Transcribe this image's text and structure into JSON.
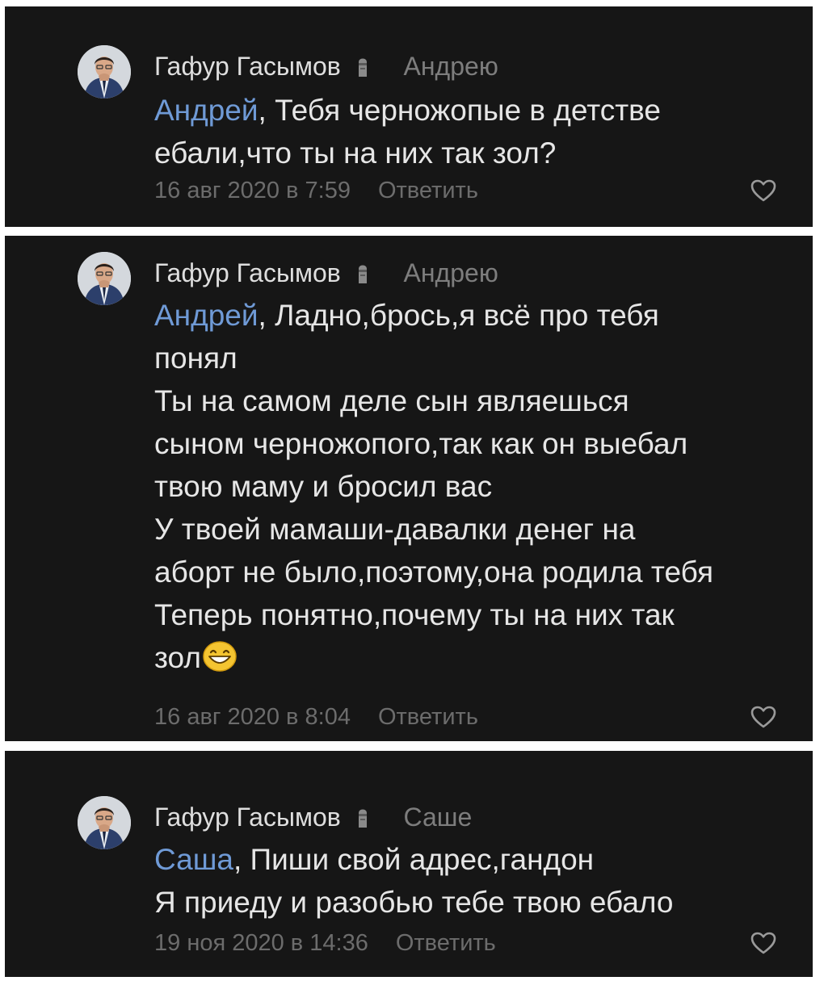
{
  "comments": [
    {
      "author": "Гафур Гасымов",
      "reply_to": "Андрею",
      "mention": "Андрей",
      "first_line": ", Тебя черножопые в детстве",
      "lines": [
        "ебали,что ты на них так зол?"
      ],
      "timestamp": "16 авг 2020 в 7:59",
      "reply_label": "Ответить"
    },
    {
      "author": "Гафур Гасымов",
      "reply_to": "Андрею",
      "mention": "Андрей",
      "first_line": ", Ладно,брось,я всё про тебя",
      "lines": [
        "понял",
        "Ты на самом деле сын являешься",
        "сыном черножопого,так как он выебал",
        "твою маму и бросил вас",
        "У твоей мамаши-давалки денег на",
        "аборт не было,поэтому,она родила тебя",
        "Теперь понятно,почему ты на них так",
        "зол"
      ],
      "timestamp": "16 авг 2020 в 8:04",
      "reply_label": "Ответить"
    },
    {
      "author": "Гафур Гасымов",
      "reply_to": "Саше",
      "mention": "Саша",
      "first_line": ", Пиши свой адрес,гандон",
      "lines": [
        "Я приеду и разобью тебе твою ебало"
      ],
      "timestamp": "19 ноя 2020 в 14:36",
      "reply_label": "Ответить"
    }
  ],
  "icons": {
    "badge": "moai-icon",
    "emoji": "grinning-smile-icon",
    "like": "heart-outline-icon"
  },
  "colors": {
    "panel_background": "#161616",
    "author_text": "#dedede",
    "mention_link": "#6f9ad6",
    "muted_text": "#6c6c6c"
  }
}
